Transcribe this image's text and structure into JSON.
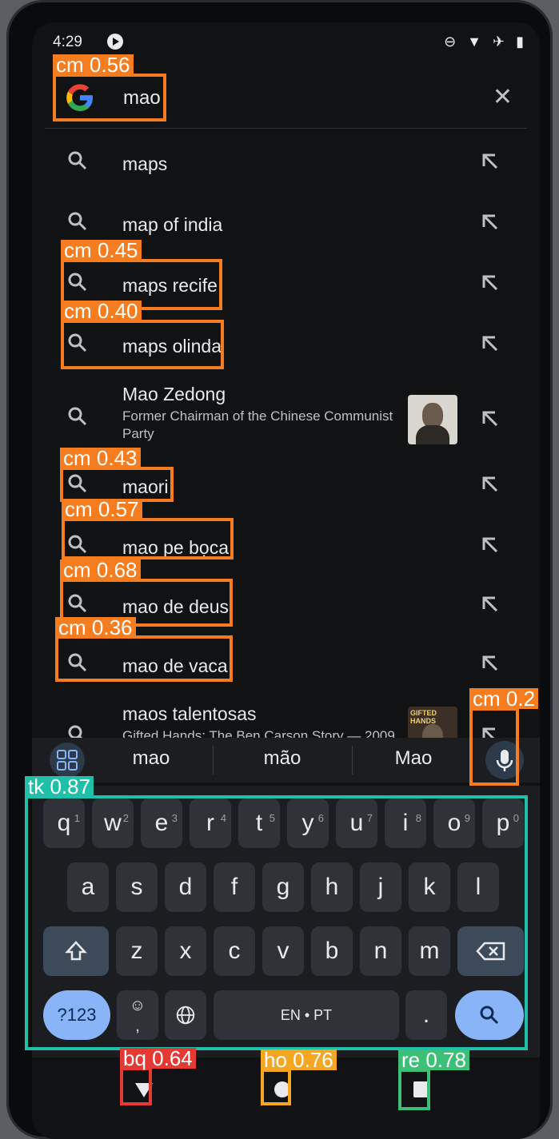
{
  "status": {
    "time": "4:29"
  },
  "search": {
    "query": "mao",
    "clear_icon": "close-icon"
  },
  "suggestions": [
    {
      "text": "maps"
    },
    {
      "text": "map of india"
    },
    {
      "text": "maps recife"
    },
    {
      "text": "maps olinda"
    },
    {
      "text": "Mao Zedong",
      "subtitle": "Former Chairman of the Chinese Communist Party",
      "thumb": "portrait"
    },
    {
      "text": "maori"
    },
    {
      "text": "mao pe bọca"
    },
    {
      "text": "mao de deus"
    },
    {
      "text": "mao de vaca"
    },
    {
      "text": "maos talentosas",
      "subtitle": "Gifted Hands: The Ben Carson Story — 2009",
      "thumb": "book",
      "thumb_text": "GIFTED HANDS"
    }
  ],
  "keyboard": {
    "suggestions": [
      "mao",
      "mão",
      "Mao"
    ],
    "row1": [
      "q",
      "w",
      "e",
      "r",
      "t",
      "y",
      "u",
      "i",
      "o",
      "p"
    ],
    "row1_hints": [
      "1",
      "2",
      "3",
      "4",
      "5",
      "6",
      "7",
      "8",
      "9",
      "0"
    ],
    "row2": [
      "a",
      "s",
      "d",
      "f",
      "g",
      "h",
      "j",
      "k",
      "l"
    ],
    "row3": [
      "z",
      "x",
      "c",
      "v",
      "b",
      "n",
      "m"
    ],
    "num_label": "?123",
    "emoji_label": "☺",
    "comma_label": ",",
    "space_label": "EN • PT",
    "period_label": "."
  },
  "annotations": [
    {
      "label": "cm 0.56",
      "color": "#f57c1f"
    },
    {
      "label": "cm 0.45",
      "color": "#f57c1f"
    },
    {
      "label": "cm 0.40",
      "color": "#f57c1f"
    },
    {
      "label": "cm 0.43",
      "color": "#f57c1f"
    },
    {
      "label": "cm 0.57",
      "color": "#f57c1f"
    },
    {
      "label": "cm 0.68",
      "color": "#f57c1f"
    },
    {
      "label": "cm 0.36",
      "color": "#f57c1f"
    },
    {
      "label": "cm 0.2",
      "color": "#f57c1f"
    },
    {
      "label": "tk 0.87",
      "color": "#1fbfa8"
    },
    {
      "label": "bq 0.64",
      "color": "#e53935"
    },
    {
      "label": "ho 0.76",
      "color": "#f5a623"
    },
    {
      "label": "re 0.78",
      "color": "#3dbf78"
    }
  ]
}
